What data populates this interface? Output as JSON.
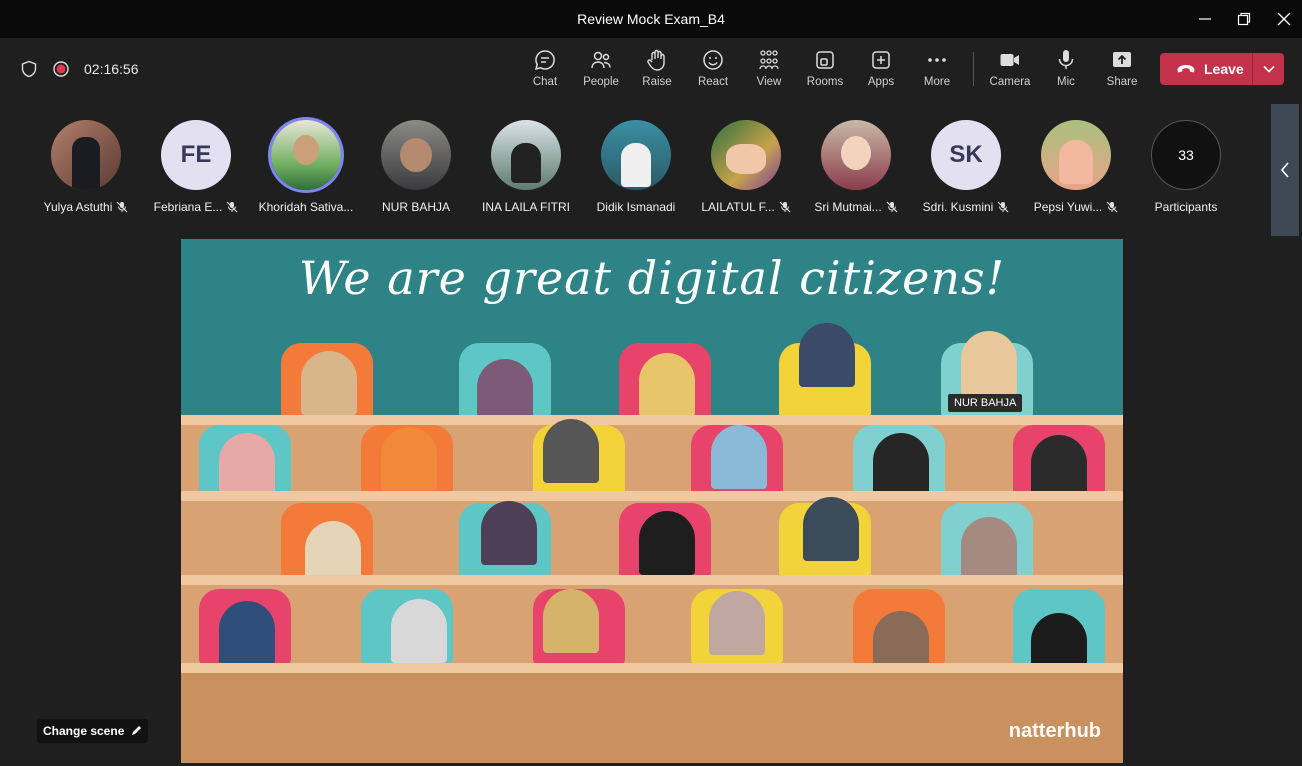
{
  "window": {
    "title": "Review Mock Exam_B4"
  },
  "meeting": {
    "timer": "02:16:56"
  },
  "toolbar": [
    {
      "label": "Chat",
      "icon": "chat-icon"
    },
    {
      "label": "People",
      "icon": "people-icon"
    },
    {
      "label": "Raise",
      "icon": "raise-hand-icon"
    },
    {
      "label": "React",
      "icon": "react-icon"
    },
    {
      "label": "View",
      "icon": "view-icon"
    },
    {
      "label": "Rooms",
      "icon": "rooms-icon"
    },
    {
      "label": "Apps",
      "icon": "apps-icon"
    },
    {
      "label": "More",
      "icon": "more-icon"
    },
    {
      "label": "Camera",
      "icon": "camera-icon"
    },
    {
      "label": "Mic",
      "icon": "mic-icon"
    },
    {
      "label": "Share",
      "icon": "share-icon"
    }
  ],
  "leave": {
    "label": "Leave"
  },
  "participants": [
    {
      "name": "Yulya Astuthi",
      "muted": true,
      "initials": ""
    },
    {
      "name": "Febriana E...",
      "muted": true,
      "initials": "FE"
    },
    {
      "name": "Khoridah Sativa...",
      "muted": false,
      "initials": ""
    },
    {
      "name": "NUR BAHJA",
      "muted": false,
      "initials": ""
    },
    {
      "name": "INA LAILA FITRI",
      "muted": false,
      "initials": ""
    },
    {
      "name": "Didik Ismanadi",
      "muted": false,
      "initials": ""
    },
    {
      "name": "LAILATUL F...",
      "muted": true,
      "initials": ""
    },
    {
      "name": "Sri Mutmai...",
      "muted": true,
      "initials": ""
    },
    {
      "name": "Sdri. Kusmini",
      "muted": true,
      "initials": "SK"
    },
    {
      "name": "Pepsi Yuwi...",
      "muted": true,
      "initials": ""
    }
  ],
  "participants_summary": {
    "count": "33",
    "label": "Participants"
  },
  "scene": {
    "headline": "We are great digital citizens!",
    "name_tag": "NUR BAHJA",
    "brand": "natterhub"
  },
  "change_scene": {
    "label": "Change scene"
  },
  "colors": {
    "accent": "#7f85f5",
    "leave": "#c4314b",
    "stage_wall": "#2e8387"
  }
}
